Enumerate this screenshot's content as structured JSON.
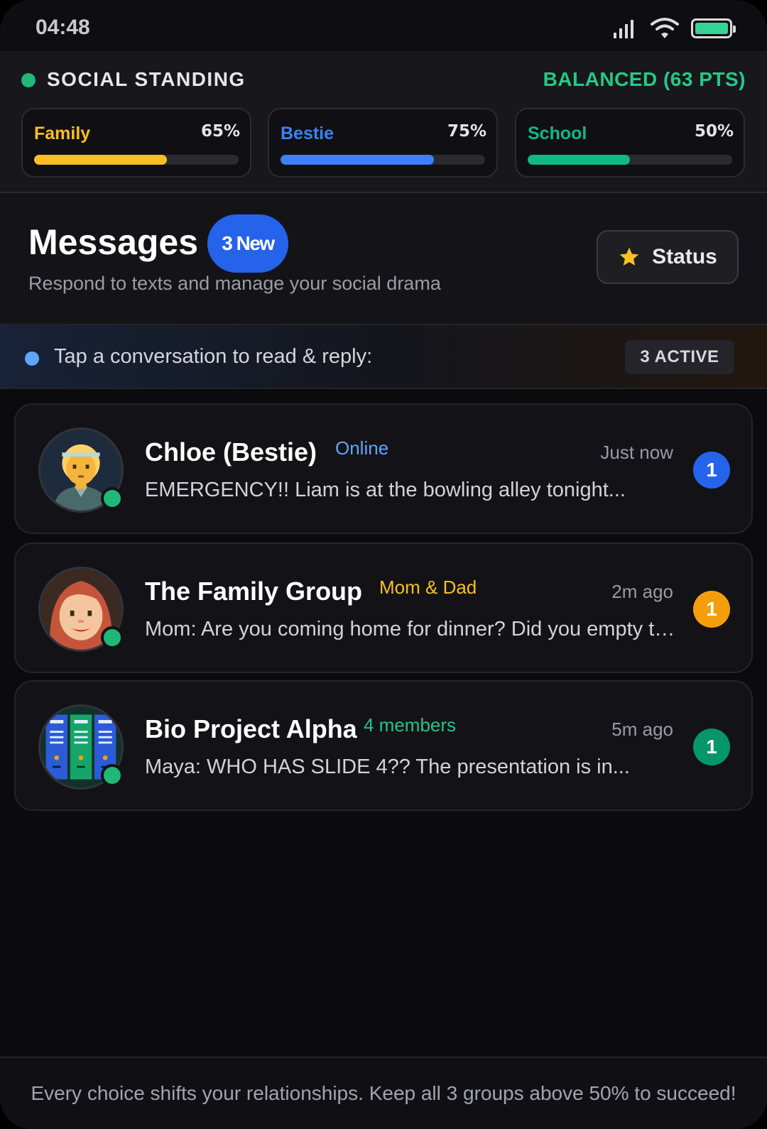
{
  "status_bar": {
    "time": "04:48"
  },
  "standing": {
    "title": "SOCIAL STANDING",
    "balance": "BALANCED (63 PTS)",
    "meters": [
      {
        "name": "Family",
        "percent_label": "65%",
        "value": 0.65,
        "color": "#fbbf24"
      },
      {
        "name": "Bestie",
        "percent_label": "75%",
        "value": 0.75,
        "color": "#3b82f6"
      },
      {
        "name": "School",
        "percent_label": "50%",
        "value": 0.5,
        "color": "#10b981"
      }
    ]
  },
  "header": {
    "title": "Messages",
    "new_badge": "3 New",
    "subtitle": "Respond to texts and manage your social drama",
    "status_button": "Status"
  },
  "hint": {
    "text": "Tap a conversation to read & reply:",
    "active": "3 ACTIVE"
  },
  "conversations": [
    {
      "name": "Chloe (Bestie)",
      "tag": "Online",
      "tag_color": "#60a5fa",
      "time": "Just now",
      "preview": "EMERGENCY!! Liam is at the bowling alley tonight...",
      "count": "1",
      "count_color": "#2563eb"
    },
    {
      "name": "The Family Group",
      "tag": "Mom & Dad",
      "tag_color": "#fbbf24",
      "time": "2m ago",
      "preview": "Mom: Are you coming home for dinner? Did you empty the dishwasher?",
      "count": "1",
      "count_color": "#f59e0b"
    },
    {
      "name": "Bio Project Alpha",
      "tag": "4 members",
      "tag_color": "#22c58b",
      "time": "5m ago",
      "preview": "Maya: WHO HAS SLIDE 4?? The presentation is in...",
      "count": "1",
      "count_color": "#059669"
    }
  ],
  "footer": {
    "text": "Every choice shifts your relationships. Keep all 3 groups above 50% to succeed!"
  }
}
